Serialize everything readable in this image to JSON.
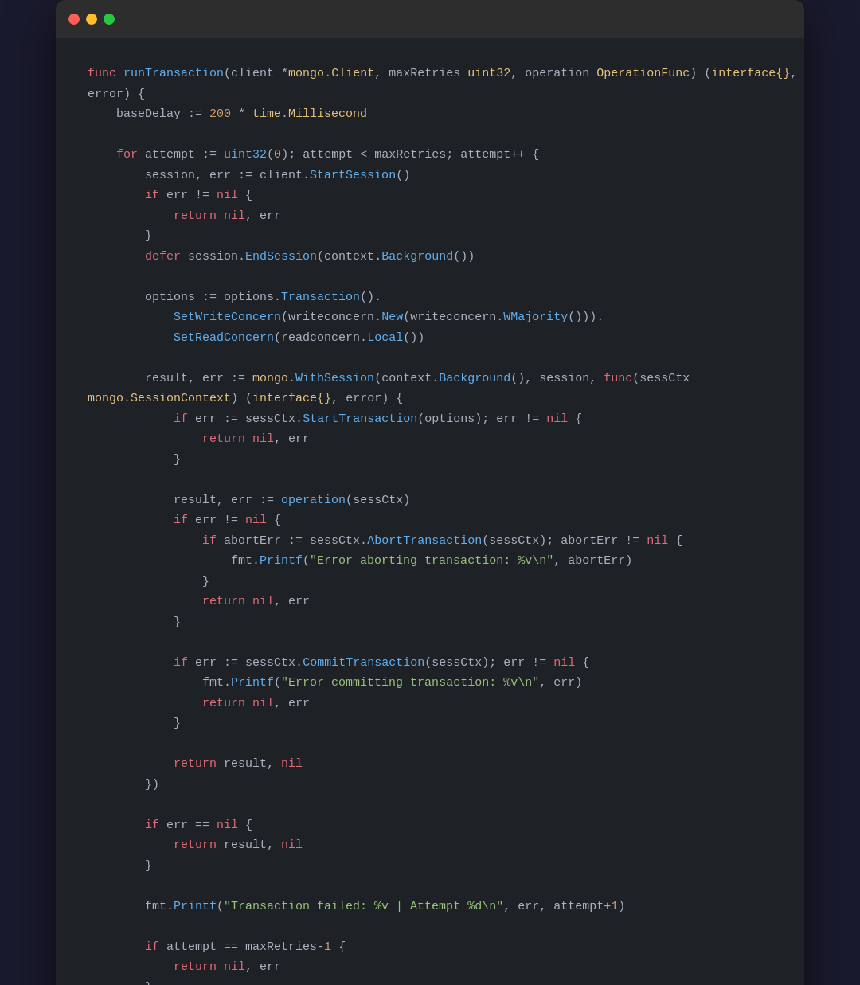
{
  "window": {
    "dots": [
      "red",
      "yellow",
      "green"
    ],
    "title": ""
  },
  "code": {
    "language": "go",
    "content": "runTransaction function"
  }
}
